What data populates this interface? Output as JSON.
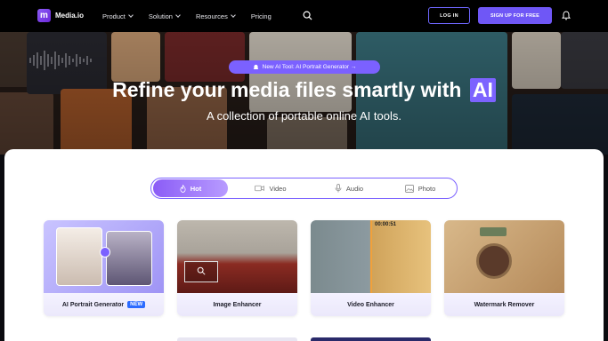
{
  "nav": {
    "logo_text": "Media.io",
    "menu": [
      "Product",
      "Solution",
      "Resources",
      "Pricing"
    ],
    "login_label": "LOG IN",
    "signup_label": "SIGN UP FOR FREE"
  },
  "hero": {
    "announcement": "New AI Tool: AI Portrait Generator →",
    "title": "Refine your media files smartly with",
    "title_highlight": "AI",
    "subtitle": "A collection of portable online AI tools."
  },
  "tabs": [
    {
      "label": "Hot",
      "icon": "flame-icon",
      "active": true
    },
    {
      "label": "Video",
      "icon": "video-icon",
      "active": false
    },
    {
      "label": "Audio",
      "icon": "mic-icon",
      "active": false
    },
    {
      "label": "Photo",
      "icon": "image-icon",
      "active": false
    }
  ],
  "cards": [
    {
      "label": "AI Portrait Generator",
      "badge": "NEW"
    },
    {
      "label": "Image Enhancer"
    },
    {
      "label": "Video Enhancer",
      "timestamp": "00:00:51"
    },
    {
      "label": "Watermark Remover"
    }
  ],
  "colors": {
    "accent": "#7b61ff",
    "nav_bg": "#000000",
    "badge_new": "#2c6bff"
  }
}
